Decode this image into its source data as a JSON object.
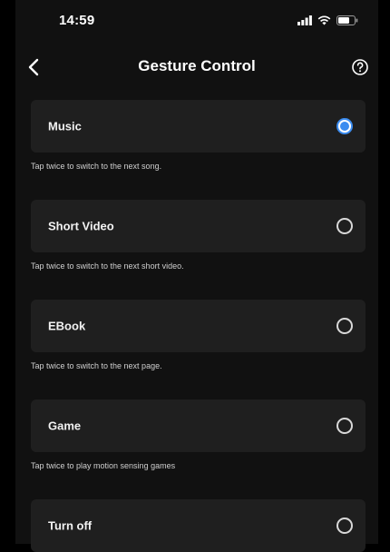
{
  "status_bar": {
    "time": "14:59",
    "icons": [
      "signal-icon",
      "wifi-icon",
      "battery-icon"
    ]
  },
  "nav": {
    "back_icon": "chevron-left-icon",
    "title": "Gesture Control",
    "help_icon": "help-icon"
  },
  "options": [
    {
      "label": "Music",
      "description": "Tap twice to switch to the next song.",
      "selected": true
    },
    {
      "label": "Short Video",
      "description": "Tap twice to switch to the next short video.",
      "selected": false
    },
    {
      "label": "EBook",
      "description": "Tap twice to switch to the next page.",
      "selected": false
    },
    {
      "label": "Game",
      "description": "Tap twice to play motion sensing games",
      "selected": false
    },
    {
      "label": "Turn off",
      "description": "",
      "selected": false
    }
  ],
  "colors": {
    "background": "#111111",
    "card": "#1f1f1f",
    "accent": "#3b8cf0",
    "text": "#ffffff",
    "description": "#cfcfcf"
  }
}
